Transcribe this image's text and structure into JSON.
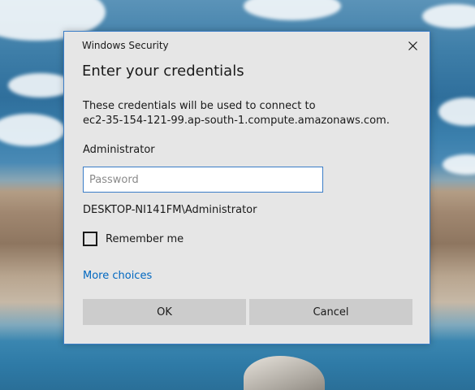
{
  "dialog": {
    "window_title": "Windows Security",
    "heading": "Enter your credentials",
    "description_line1": "These credentials will be used to connect to",
    "description_line2": "ec2-35-154-121-99.ap-south-1.compute.amazonaws.com.",
    "username": "Administrator",
    "password": {
      "value": "",
      "placeholder": "Password"
    },
    "domain_user": "DESKTOP-NI141FM\\Administrator",
    "remember_me": {
      "label": "Remember me",
      "checked": false
    },
    "more_choices_label": "More choices",
    "ok_label": "OK",
    "cancel_label": "Cancel",
    "close_icon": "close-icon"
  },
  "colors": {
    "dialog_background": "#e6e6e6",
    "accent_border": "#3b7dc7",
    "link": "#0067c0",
    "button_background": "#cccccc"
  }
}
